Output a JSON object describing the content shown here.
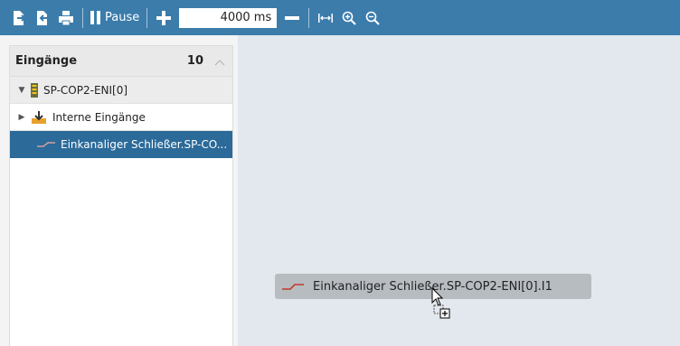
{
  "toolbar": {
    "icons": [
      "export-icon",
      "import-icon",
      "print-icon"
    ],
    "pause_label": "Pause",
    "interval_value": "4000 ms",
    "nav_icons": [
      "fit-width-icon",
      "zoom-in-icon",
      "zoom-out-icon"
    ],
    "color": "#3b7cab"
  },
  "inputs_panel": {
    "title": "Eingänge",
    "count": "10",
    "collapse_icon": "chevron-up-icon",
    "tree": {
      "device": {
        "label": "SP-COP2-ENI[0]",
        "expanded": true,
        "icon": "device-icon"
      },
      "group": {
        "label": "Interne Eingänge",
        "expanded": false,
        "icon": "folder-download-icon"
      },
      "selected_item": {
        "label": "Einkanaliger Schließer.SP-CO...",
        "icon": "signal-line-icon"
      }
    }
  },
  "drag_ghost": {
    "label": "Einkanaliger Schließer.SP-COP2-ENI[0].I1",
    "icon": "signal-line-icon",
    "cursor": "drag-copy-cursor-icon"
  },
  "colors": {
    "selection": "#2b6a99",
    "canvas": "#e2e8ee",
    "signal": "#c0392b"
  }
}
